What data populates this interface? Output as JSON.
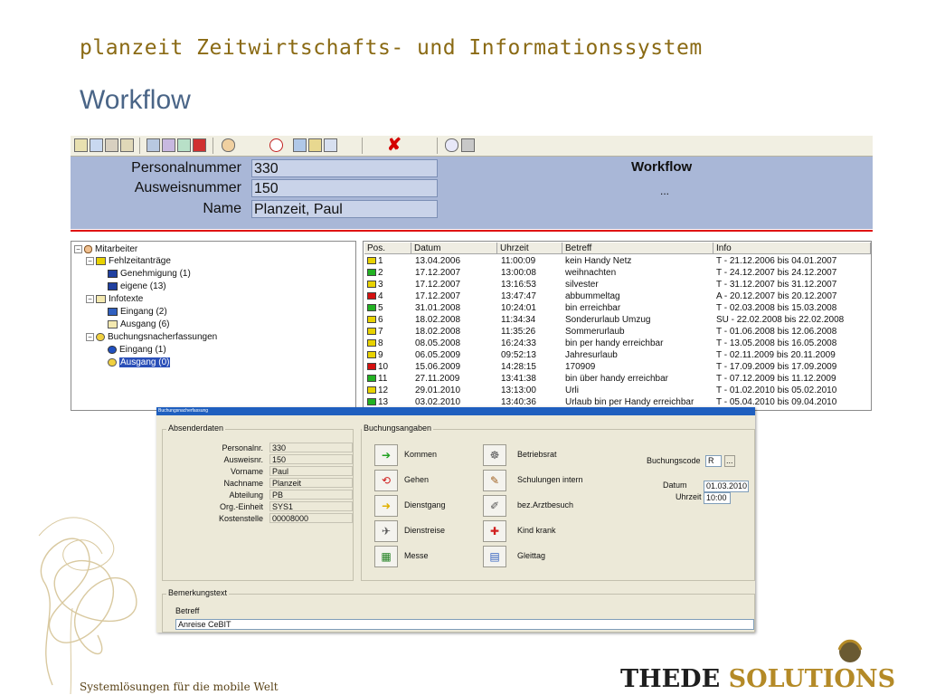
{
  "slide": {
    "heading": "planzeit Zeitwirtschafts- und Informationssystem",
    "subheading": "Workflow",
    "footer": "Systemlösungen für die mobile Welt",
    "logo_part1": "THEDE ",
    "logo_part2": "SOLUTIONS"
  },
  "colors": {
    "header_bg": "#a9b7d7",
    "accent_red": "#e01414",
    "selection": "#2a4fb8",
    "heading": "#8a6a14",
    "subheading": "#4a6587"
  },
  "toolbar": {
    "icons": [
      "open-icon",
      "search-icon",
      "report-icon",
      "list-icon",
      "print-icon",
      "users-icon",
      "group-icon",
      "export-icon",
      "user-icon",
      "refresh-icon",
      "find-icon",
      "calc-icon",
      "grid-icon",
      "cancel-icon",
      "info-icon",
      "settings-icon"
    ]
  },
  "header": {
    "labels": [
      "Personalnummer",
      "Ausweisnummer",
      "Name"
    ],
    "values": [
      "330",
      "150",
      "Planzeit, Paul"
    ],
    "workflow_title": "Workflow",
    "workflow_text": "..."
  },
  "tree": {
    "items": [
      {
        "label": "Mitarbeiter",
        "icon": "person-icon"
      },
      {
        "label": "Fehlzeitanträge",
        "icon": "folder-icon"
      },
      {
        "label": "Genehmigung (1)",
        "icon": "approval-icon"
      },
      {
        "label": "eigene (13)",
        "icon": "own-icon"
      },
      {
        "label": "Infotexte",
        "icon": "mail-icon"
      },
      {
        "label": "Eingang (2)",
        "icon": "inbox-icon"
      },
      {
        "label": "Ausgang (6)",
        "icon": "outbox-icon"
      },
      {
        "label": "Buchungsnacherfassungen",
        "icon": "booking-icon"
      },
      {
        "label": "Eingang (1)",
        "icon": "incoming-booking-icon"
      },
      {
        "label": "Ausgang (0)",
        "icon": "outgoing-booking-icon"
      }
    ]
  },
  "table": {
    "columns": [
      "Pos.",
      "Datum",
      "Uhrzeit",
      "Betreff",
      "Info"
    ],
    "rows": [
      {
        "flag": "#e8d200",
        "pos": "1",
        "datum": "13.04.2006",
        "uhrzeit": "11:00:09",
        "betreff": "kein Handy Netz",
        "info": "T - 21.12.2006 bis 04.01.2007"
      },
      {
        "flag": "#22b222",
        "pos": "2",
        "datum": "17.12.2007",
        "uhrzeit": "13:00:08",
        "betreff": "weihnachten",
        "info": "T - 24.12.2007 bis 24.12.2007"
      },
      {
        "flag": "#e8d200",
        "pos": "3",
        "datum": "17.12.2007",
        "uhrzeit": "13:16:53",
        "betreff": "silvester",
        "info": "T - 31.12.2007 bis 31.12.2007"
      },
      {
        "flag": "#d41010",
        "pos": "4",
        "datum": "17.12.2007",
        "uhrzeit": "13:47:47",
        "betreff": "abbummeltag",
        "info": "A - 20.12.2007 bis 20.12.2007"
      },
      {
        "flag": "#22b222",
        "pos": "5",
        "datum": "31.01.2008",
        "uhrzeit": "10:24:01",
        "betreff": "bin erreichbar",
        "info": "T - 02.03.2008 bis 15.03.2008"
      },
      {
        "flag": "#e8d200",
        "pos": "6",
        "datum": "18.02.2008",
        "uhrzeit": "11:34:34",
        "betreff": "Sonderurlaub Umzug",
        "info": "SU - 22.02.2008 bis 22.02.2008"
      },
      {
        "flag": "#e8d200",
        "pos": "7",
        "datum": "18.02.2008",
        "uhrzeit": "11:35:26",
        "betreff": "Sommerurlaub",
        "info": "T - 01.06.2008 bis 12.06.2008"
      },
      {
        "flag": "#e8d200",
        "pos": "8",
        "datum": "08.05.2008",
        "uhrzeit": "16:24:33",
        "betreff": "bin per handy erreichbar",
        "info": "T - 13.05.2008 bis 16.05.2008"
      },
      {
        "flag": "#e8d200",
        "pos": "9",
        "datum": "06.05.2009",
        "uhrzeit": "09:52:13",
        "betreff": "Jahresurlaub",
        "info": "T - 02.11.2009 bis 20.11.2009"
      },
      {
        "flag": "#d41010",
        "pos": "10",
        "datum": "15.06.2009",
        "uhrzeit": "14:28:15",
        "betreff": "170909",
        "info": "T - 17.09.2009 bis 17.09.2009"
      },
      {
        "flag": "#22b222",
        "pos": "11",
        "datum": "27.11.2009",
        "uhrzeit": "13:41:38",
        "betreff": "bin über handy erreichbar",
        "info": "T - 07.12.2009 bis 11.12.2009"
      },
      {
        "flag": "#e8d200",
        "pos": "12",
        "datum": "29.01.2010",
        "uhrzeit": "13:13:00",
        "betreff": "Urli",
        "info": "T - 01.02.2010 bis 05.02.2010"
      },
      {
        "flag": "#22b222",
        "pos": "13",
        "datum": "03.02.2010",
        "uhrzeit": "13:40:36",
        "betreff": "Urlaub bin per Handy erreichbar",
        "info": "T - 05.04.2010 bis 09.04.2010"
      }
    ]
  },
  "dialog": {
    "title": "Buchungsnacherfassung",
    "sender_legend": "Absenderdaten",
    "sender_fields": [
      {
        "label": "Personalnr.",
        "value": "330"
      },
      {
        "label": "Ausweisnr.",
        "value": "150"
      },
      {
        "label": "Vorname",
        "value": "Paul"
      },
      {
        "label": "Nachname",
        "value": "Planzeit"
      },
      {
        "label": "Abteilung",
        "value": "PB"
      },
      {
        "label": "Org.-Einheit",
        "value": "SYS1"
      },
      {
        "label": "Kostenstelle",
        "value": "00008000"
      }
    ],
    "booking_legend": "Buchungsangaben",
    "buttons_left": [
      {
        "label": "Kommen",
        "icon": "arrow-in-icon"
      },
      {
        "label": "Gehen",
        "icon": "arrow-out-icon"
      },
      {
        "label": "Dienstgang",
        "icon": "errand-icon"
      },
      {
        "label": "Dienstreise",
        "icon": "travel-icon"
      },
      {
        "label": "Messe",
        "icon": "fair-icon"
      }
    ],
    "buttons_right": [
      {
        "label": "Betriebsrat",
        "icon": "council-icon"
      },
      {
        "label": "Schulungen intern",
        "icon": "training-icon"
      },
      {
        "label": "bez.Arztbesuch",
        "icon": "doctor-icon"
      },
      {
        "label": "Kind krank",
        "icon": "child-sick-icon"
      },
      {
        "label": "Gleittag",
        "icon": "flexday-icon"
      }
    ],
    "buchungscode_label": "Buchungscode",
    "buchungscode_value": "R",
    "browse_label": "...",
    "datum_label": "Datum",
    "datum_value": "01.03.2010",
    "uhrzeit_label": "Uhrzeit",
    "uhrzeit_value": "10:00",
    "remark_legend": "Bemerkungstext",
    "betreff_label": "Betreff",
    "betreff_value": "Anreise CeBIT"
  }
}
